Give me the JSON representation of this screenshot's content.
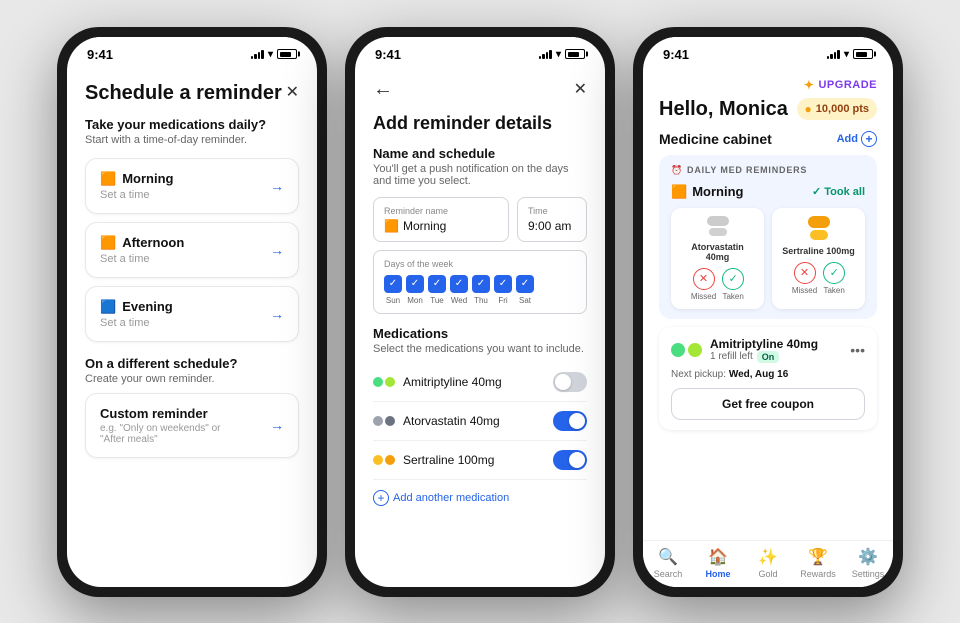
{
  "phone1": {
    "status_time": "9:41",
    "title": "Schedule a reminder",
    "close_label": "✕",
    "subtitle": "Take your medications daily?",
    "desc": "Start with a time-of-day reminder.",
    "options": [
      {
        "icon": "🟧",
        "label": "Morning",
        "sub": "Set a time"
      },
      {
        "icon": "🟧",
        "label": "Afternoon",
        "sub": "Set a time"
      },
      {
        "icon": "🟦",
        "label": "Evening",
        "sub": "Set a time"
      }
    ],
    "different_label": "On a different schedule?",
    "different_desc": "Create your own reminder.",
    "custom_label": "Custom reminder",
    "custom_sub": "e.g. \"Only on weekends\" or\n\"After meals\""
  },
  "phone2": {
    "status_time": "9:41",
    "back_icon": "←",
    "close_icon": "✕",
    "title": "Add reminder details",
    "section_title": "Name and schedule",
    "section_desc": "You'll get a push notification on the days and time you select.",
    "reminder_name_label": "Reminder name",
    "reminder_name_value": "🟧 Morning",
    "time_label": "Time",
    "time_value": "9:00 am",
    "days_label": "Days of the week",
    "days": [
      "Sun",
      "Mon",
      "Tue",
      "Wed",
      "Thu",
      "Fri",
      "Sat"
    ],
    "meds_title": "Medications",
    "meds_subtitle": "Select the medications you want to include.",
    "medications": [
      {
        "name": "Amitriptyline 40mg",
        "color1": "#4ade80",
        "color2": "#a3e635",
        "enabled": false
      },
      {
        "name": "Atorvastatin 40mg",
        "color1": "#9ca3af",
        "color2": "#9ca3af",
        "enabled": true
      },
      {
        "name": "Sertraline 100mg",
        "color1": "#fbbf24",
        "color2": "#f59e0b",
        "enabled": true
      }
    ],
    "add_med_label": "Add another medication"
  },
  "phone3": {
    "status_time": "9:41",
    "upgrade_label": "UPGRADE",
    "greeting": "Hello, Monica",
    "points": "10,000 pts",
    "cabinet_title": "Medicine cabinet",
    "add_label": "Add",
    "reminders_label": "DAILY MED REMINDERS",
    "morning_label": "Morning",
    "took_all_label": "Took all",
    "med_cards": [
      {
        "name": "Atorvastatin 40mg",
        "type": "white"
      },
      {
        "name": "Sertraline 100mg",
        "type": "yellow"
      }
    ],
    "missed_label": "Missed",
    "taken_label": "Taken",
    "ami_name": "Amitriptyline 40mg",
    "ami_sub": "1 refill left",
    "ami_on": "On",
    "pickup_text": "Next pickup: ",
    "pickup_date": "Wed, Aug 16",
    "coupon_label": "Get free coupon",
    "nav_items": [
      {
        "icon": "🔍",
        "label": "Search"
      },
      {
        "icon": "🏠",
        "label": "Home",
        "active": true
      },
      {
        "icon": "✨",
        "label": "Gold"
      },
      {
        "icon": "🏆",
        "label": "Rewards"
      },
      {
        "icon": "⚙️",
        "label": "Settings"
      }
    ]
  }
}
